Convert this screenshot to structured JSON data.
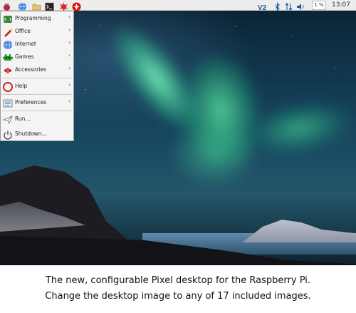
{
  "taskbar": {
    "cpu_label": "1 %",
    "clock": "13:07",
    "icons": [
      "raspberry-icon",
      "globe-icon",
      "folder-icon",
      "terminal-icon",
      "burst-icon",
      "wolfram-icon"
    ],
    "tray_icons": [
      "vnc-icon",
      "bluetooth-icon",
      "network-icon",
      "volume-icon"
    ]
  },
  "menu": {
    "items": [
      {
        "label": "Programming",
        "icon": "programming-icon",
        "submenu": true
      },
      {
        "label": "Office",
        "icon": "office-icon",
        "submenu": true
      },
      {
        "label": "Internet",
        "icon": "internet-icon",
        "submenu": true
      },
      {
        "label": "Games",
        "icon": "games-icon",
        "submenu": true
      },
      {
        "label": "Accessories",
        "icon": "accessories-icon",
        "submenu": true
      },
      {
        "label": "Help",
        "icon": "help-icon",
        "submenu": true
      },
      {
        "label": "Preferences",
        "icon": "preferences-icon",
        "submenu": true
      },
      {
        "label": "Run...",
        "icon": "run-icon",
        "submenu": false
      },
      {
        "label": "Shutdown...",
        "icon": "shutdown-icon",
        "submenu": false
      }
    ],
    "arrow": "›"
  },
  "caption": {
    "line1": "The new, configurable Pixel desktop for the Raspberry Pi.",
    "line2": "Change the desktop image to any of 17 included images."
  }
}
